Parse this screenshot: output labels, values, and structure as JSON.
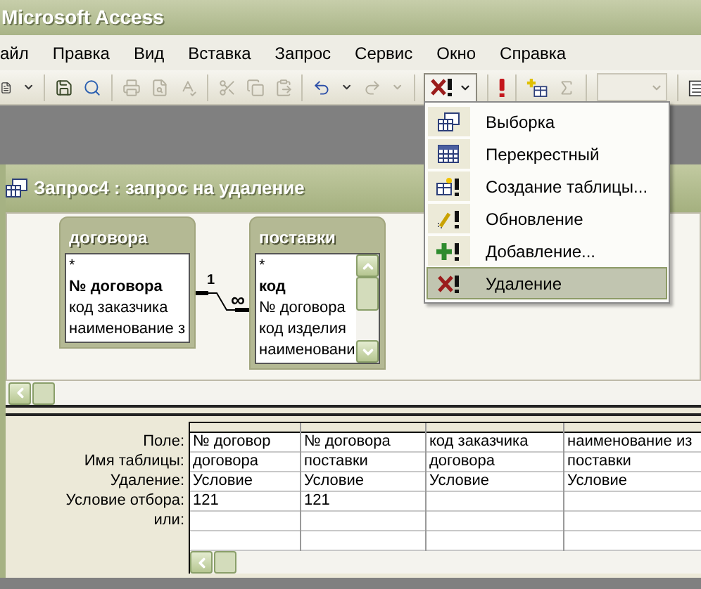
{
  "app_title": "Microsoft Access",
  "menu": [
    "айл",
    "Правка",
    "Вид",
    "Вставка",
    "Запрос",
    "Сервис",
    "Окно",
    "Справка"
  ],
  "toolbar": [
    {
      "kind": "new",
      "disabled": false
    },
    {
      "kind": "arrow",
      "disabled": false
    },
    {
      "kind": "sep"
    },
    {
      "kind": "save",
      "disabled": false
    },
    {
      "kind": "search",
      "disabled": false
    },
    {
      "kind": "sep"
    },
    {
      "kind": "print",
      "disabled": true
    },
    {
      "kind": "preview",
      "disabled": true
    },
    {
      "kind": "spell",
      "disabled": true
    },
    {
      "kind": "sep"
    },
    {
      "kind": "cut",
      "disabled": true
    },
    {
      "kind": "copy",
      "disabled": true
    },
    {
      "kind": "paste",
      "disabled": true
    },
    {
      "kind": "sep"
    },
    {
      "kind": "undo",
      "disabled": false
    },
    {
      "kind": "arrow",
      "disabled": false
    },
    {
      "kind": "redo",
      "disabled": true
    },
    {
      "kind": "arrow",
      "disabled": true
    },
    {
      "kind": "sep"
    },
    {
      "kind": "query_type",
      "disabled": false,
      "open": true
    },
    {
      "kind": "sep"
    },
    {
      "kind": "run",
      "disabled": false
    },
    {
      "kind": "sep"
    },
    {
      "kind": "show_table",
      "disabled": false
    },
    {
      "kind": "sigma",
      "disabled": true
    },
    {
      "kind": "sep"
    },
    {
      "kind": "combo",
      "disabled": true
    },
    {
      "kind": "sep"
    },
    {
      "kind": "properties",
      "disabled": false
    }
  ],
  "query_type_menu": [
    {
      "kind": "select",
      "label": "Выборка",
      "selected": false
    },
    {
      "kind": "crosstab",
      "label": "Перекрестный",
      "selected": false
    },
    {
      "kind": "make_table",
      "label": "Создание таблицы...",
      "selected": false
    },
    {
      "kind": "update",
      "label": "Обновление",
      "selected": false
    },
    {
      "kind": "append",
      "label": "Добавление...",
      "selected": false
    },
    {
      "kind": "delete",
      "label": "Удаление",
      "selected": true
    }
  ],
  "query_window": {
    "title": "Запрос4 : запрос на удаление",
    "tables": [
      {
        "name": "договора",
        "scrollbar": false,
        "fields": [
          {
            "name": "*",
            "key": false
          },
          {
            "name": "№ договора",
            "key": true
          },
          {
            "name": "код заказчика",
            "key": false
          },
          {
            "name": "наименование з",
            "key": false
          }
        ]
      },
      {
        "name": "поставки",
        "scrollbar": true,
        "fields": [
          {
            "name": "*",
            "key": false
          },
          {
            "name": "код",
            "key": true
          },
          {
            "name": "№ договора",
            "key": false
          },
          {
            "name": "код изделия",
            "key": false
          },
          {
            "name": "наименовани",
            "key": false
          }
        ]
      }
    ],
    "relation": {
      "one": "1",
      "many": "∞"
    }
  },
  "grid": {
    "row_labels": [
      "Поле:",
      "Имя таблицы:",
      "Удаление:",
      "Условие отбора:",
      "или:"
    ],
    "columns": [
      {
        "field": "№ договор",
        "table": "договора",
        "delete": "Условие",
        "criteria": "121"
      },
      {
        "field": "№ договора",
        "table": "поставки",
        "delete": "Условие",
        "criteria": "121"
      },
      {
        "field": "код заказчика",
        "table": "договора",
        "delete": "Условие"
      },
      {
        "field": "наименование из",
        "table": "поставки",
        "delete": "Условие"
      }
    ]
  }
}
